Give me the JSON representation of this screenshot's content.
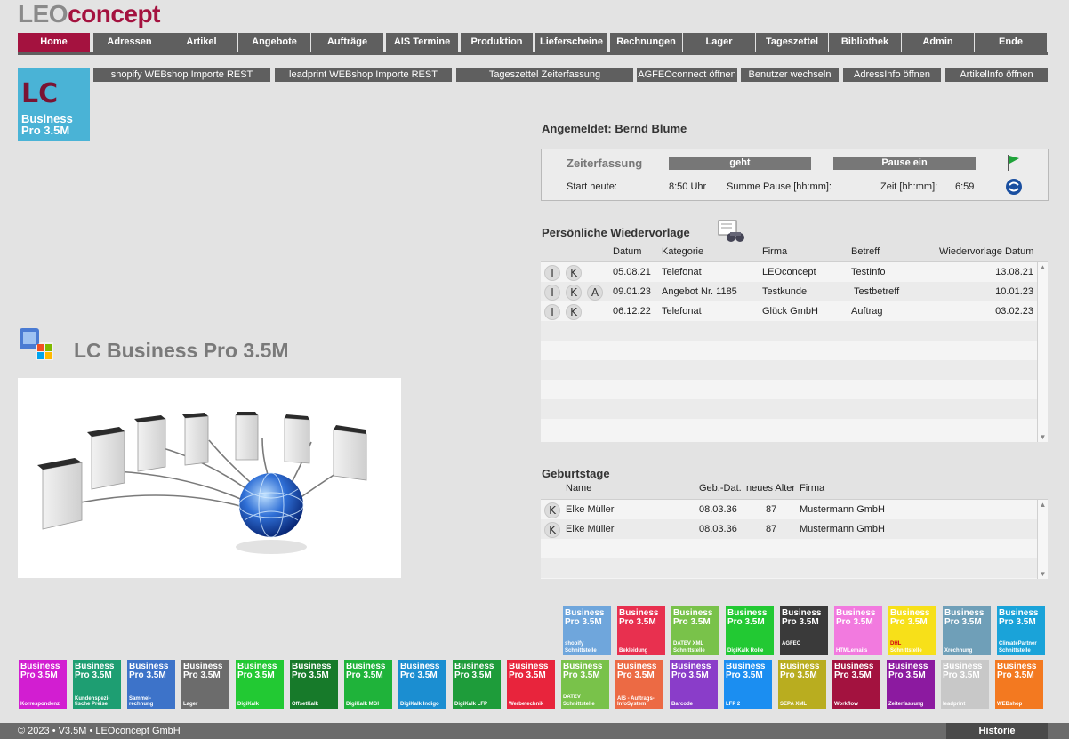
{
  "logo": {
    "part1": "LEO",
    "part2": "concept"
  },
  "main_nav": [
    "Home",
    "Adressen",
    "Artikel",
    "Angebote",
    "Aufträge",
    "AIS Termine",
    "Produktion",
    "Lieferscheine",
    "Rechnungen",
    "Lager",
    "Tageszettel",
    "Bibliothek",
    "Admin",
    "Ende"
  ],
  "sub_nav": [
    "shopify WEBshop Importe REST",
    "leadprint WEBshop Importe REST",
    "Tageszettel Zeiterfassung",
    "AGFEOconnect öffnen",
    "Benutzer wechseln",
    "AdressInfo öffnen",
    "ArtikelInfo öffnen"
  ],
  "app_icon": {
    "lc": "LC",
    "line1": "Business",
    "line2": "Pro 3.5M"
  },
  "product_title": "LC Business Pro 3.5M",
  "logged_in": "Angemeldet: Bernd Blume",
  "zeit": {
    "title": "Zeiterfassung",
    "geht": "geht",
    "pause": "Pause ein",
    "start_label": "Start heute:",
    "start_value": "8:50 Uhr",
    "pause_label": "Summe Pause [hh:mm]:",
    "zeit_label": "Zeit [hh:mm]:",
    "zeit_value": "6:59"
  },
  "wiedervorlage": {
    "title": "Persönliche Wiedervorlage",
    "headers": {
      "datum": "Datum",
      "kategorie": "Kategorie",
      "firma": "Firma",
      "betreff": "Betreff",
      "wv": "Wiedervorlage Datum"
    },
    "rows": [
      {
        "icons": [
          "I",
          "K"
        ],
        "datum": "05.08.21",
        "kategorie": "Telefonat",
        "firma": "LEOconcept",
        "betreff": "TestInfo",
        "wv": "13.08.21"
      },
      {
        "icons": [
          "I",
          "K",
          "A"
        ],
        "datum": "09.01.23",
        "kategorie": "Angebot Nr. 1185",
        "firma": "Testkunde",
        "betreff": "Testbetreff",
        "wv": "10.01.23"
      },
      {
        "icons": [
          "I",
          "K"
        ],
        "datum": "06.12.22",
        "kategorie": "Telefonat",
        "firma": "Glück GmbH",
        "betreff": "Auftrag",
        "wv": "03.02.23"
      }
    ]
  },
  "geburtstage": {
    "title": "Geburtstage",
    "headers": {
      "name": "Name",
      "geb": "Geb.-Dat.",
      "alter": "neues Alter",
      "firma": "Firma"
    },
    "rows": [
      {
        "icon": "K",
        "name": "Elke Müller",
        "geb": "08.03.36",
        "alter": "87",
        "firma": "Mustermann GmbH"
      },
      {
        "icon": "K",
        "name": "Elke Müller",
        "geb": "08.03.36",
        "alter": "87",
        "firma": "Mustermann GmbH"
      }
    ]
  },
  "tiles_top": [
    {
      "l1": "Business",
      "l2": "Pro 3.5M",
      "label": "Schnittstelle",
      "logo": "shopify",
      "color": "#6fa6dc"
    },
    {
      "l1": "Business",
      "l2": "Pro 3.5M",
      "label": "Bekleidung",
      "logo": "",
      "color": "#e8304f"
    },
    {
      "l1": "Business",
      "l2": "Pro 3.5M",
      "label": "Schnittstelle",
      "logo": "DATEV XML",
      "color": "#79c24a"
    },
    {
      "l1": "Business",
      "l2": "Pro 3.5M",
      "label": "DigiKalk Rolle",
      "logo": "",
      "color": "#22c933"
    },
    {
      "l1": "Business",
      "l2": "Pro 3.5M",
      "label": "",
      "logo": "AGFEO",
      "color": "#3a3a3a"
    },
    {
      "l1": "Business",
      "l2": "Pro 3.5M",
      "label": "HTMLemails",
      "logo": "",
      "color": "#f27adf"
    },
    {
      "l1": "Business",
      "l2": "Pro 3.5M",
      "label": "Schnittstelle",
      "logo": "DHL",
      "color": "#f7e019"
    },
    {
      "l1": "Business",
      "l2": "Pro 3.5M",
      "label": "Xrechnung",
      "logo": "",
      "color": "#6f9fb8"
    },
    {
      "l1": "Business",
      "l2": "Pro 3.5M",
      "label": "Schnittstelle",
      "logo": "ClimatePartner",
      "color": "#1aa3d9"
    }
  ],
  "tiles_bottom": [
    {
      "l1": "Business",
      "l2": "Pro 3.5M",
      "label": "Korrespondenz",
      "color": "#d21ed1"
    },
    {
      "l1": "Business",
      "l2": "Pro 3.5M",
      "label": "Kundenspezi-fische Preise",
      "color": "#1e9e72"
    },
    {
      "l1": "Business",
      "l2": "Pro 3.5M",
      "label": "Sammel-rechnung",
      "color": "#3d73c9"
    },
    {
      "l1": "Business",
      "l2": "Pro 3.5M",
      "label": "Lager",
      "color": "#6c6c6c"
    },
    {
      "l1": "Business",
      "l2": "Pro 3.5M",
      "label": "DigiKalk",
      "color": "#22c933"
    },
    {
      "l1": "Business",
      "l2": "Pro 3.5M",
      "label": "OffsetKalk",
      "color": "#177a2a"
    },
    {
      "l1": "Business",
      "l2": "Pro 3.5M",
      "label": "DigiKalk MGI",
      "color": "#1fb33a"
    },
    {
      "l1": "Business",
      "l2": "Pro 3.5M",
      "label": "DigiKalk Indigo",
      "color": "#1b8ed1"
    },
    {
      "l1": "Business",
      "l2": "Pro 3.5M",
      "label": "DigiKalk LFP",
      "color": "#1e9c3a"
    },
    {
      "l1": "Business",
      "l2": "Pro 3.5M",
      "label": "Werbetechnik",
      "color": "#e8243c"
    },
    {
      "l1": "Business",
      "l2": "Pro 3.5M",
      "label": "Schnittstelle",
      "logo": "DATEV",
      "color": "#79c24a"
    },
    {
      "l1": "Business",
      "l2": "Pro 3.5M",
      "label": "AIS - Auftrags-InfoSystem",
      "color": "#ec6a44"
    },
    {
      "l1": "Business",
      "l2": "Pro 3.5M",
      "label": "Barcode",
      "color": "#8a3dc9"
    },
    {
      "l1": "Business",
      "l2": "Pro 3.5M",
      "label": "LFP 2",
      "color": "#1b8ef1"
    },
    {
      "l1": "Business",
      "l2": "Pro 3.5M",
      "label": "SEPA XML",
      "color": "#b9ad1f"
    },
    {
      "l1": "Business",
      "l2": "Pro 3.5M",
      "label": "Workflow",
      "color": "#a3123f"
    },
    {
      "l1": "Business",
      "l2": "Pro 3.5M",
      "label": "Zeiterfassung",
      "color": "#8c1aa0"
    },
    {
      "l1": "Business",
      "l2": "Pro 3.5M",
      "label": "leadprint",
      "color": "#c8c8c8"
    },
    {
      "l1": "Business",
      "l2": "Pro 3.5M",
      "label": "WEBshop",
      "color": "#f37920"
    }
  ],
  "footer": {
    "copyright": "© 2023 • V3.5M • LEOconcept GmbH",
    "historie": "Historie"
  },
  "colors": {
    "accent": "#a4123f",
    "nav": "#5f5f5f"
  }
}
